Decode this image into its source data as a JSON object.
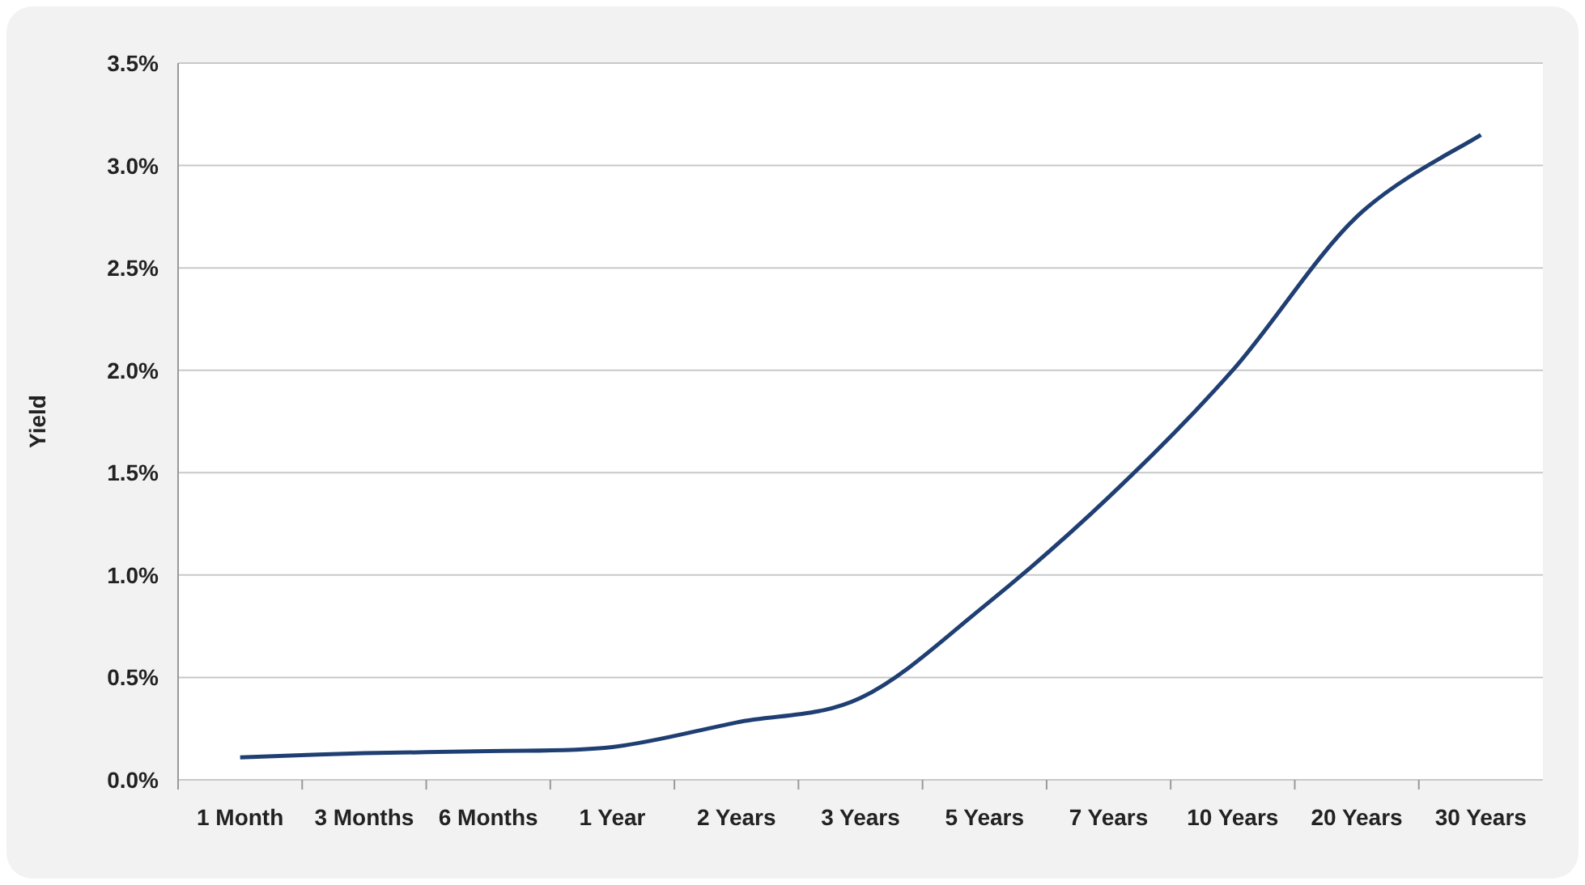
{
  "chart": {
    "chart_data": {
      "type": "line",
      "ylabel": "Yield",
      "categories": [
        "1 Month",
        "3 Months",
        "6 Months",
        "1 Year",
        "2 Years",
        "3 Years",
        "5 Years",
        "7 Years",
        "10 Years",
        "20 Years",
        "30 Years"
      ],
      "grid": true,
      "series": [
        {
          "color": "#1f3f73",
          "values": [
            0.11,
            0.13,
            0.14,
            0.16,
            0.28,
            0.4,
            0.85,
            1.38,
            2.0,
            2.75,
            3.15
          ]
        }
      ],
      "ylim": [
        0,
        3.5
      ],
      "yticks": [
        {
          "value": 0,
          "label": "0.0%"
        },
        {
          "value": 0.5,
          "label": "0.5%"
        },
        {
          "value": 1,
          "label": "1.0%"
        },
        {
          "value": 1.5,
          "label": "1.5%"
        },
        {
          "value": 2,
          "label": "2.0%"
        },
        {
          "value": 2.5,
          "label": "2.5%"
        },
        {
          "value": 3,
          "label": "3.0%"
        },
        {
          "value": 3.5,
          "label": "3.5%"
        }
      ]
    }
  }
}
